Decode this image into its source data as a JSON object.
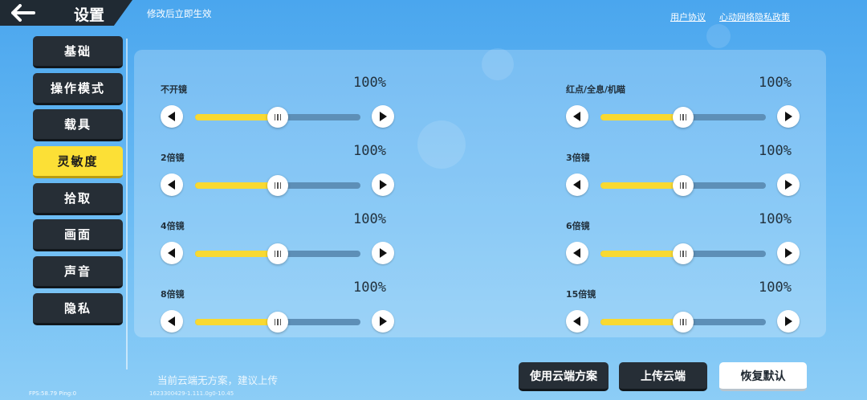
{
  "header": {
    "title": "设置",
    "hint": "修改后立即生效",
    "links": [
      "用户协议",
      "心动网络隐私政策"
    ]
  },
  "sidebar": {
    "items": [
      {
        "label": "基础"
      },
      {
        "label": "操作模式"
      },
      {
        "label": "载具"
      },
      {
        "label": "灵敏度",
        "active": true
      },
      {
        "label": "拾取"
      },
      {
        "label": "画面"
      },
      {
        "label": "声音"
      },
      {
        "label": "隐私"
      }
    ]
  },
  "sliders": [
    {
      "label": "不开镜",
      "value": "100%",
      "level": 0.5
    },
    {
      "label": "红点/全息/机瞄",
      "value": "100%",
      "level": 0.5
    },
    {
      "label": "2倍镜",
      "value": "100%",
      "level": 0.5
    },
    {
      "label": "3倍镜",
      "value": "100%",
      "level": 0.5
    },
    {
      "label": "4倍镜",
      "value": "100%",
      "level": 0.5
    },
    {
      "label": "6倍镜",
      "value": "100%",
      "level": 0.5
    },
    {
      "label": "8倍镜",
      "value": "100%",
      "level": 0.5
    },
    {
      "label": "15倍镜",
      "value": "100%",
      "level": 0.5
    }
  ],
  "footer": {
    "cloud_note": "当前云端无方案，建议上传",
    "use_cloud_label": "使用云端方案",
    "upload_label": "上传云端",
    "restore_label": "恢复默认",
    "fps": "FPS:58.79 Ping:0",
    "build": "1623300429-1.111.0g0-10.45"
  },
  "colors": {
    "accent_yellow": "#fce036",
    "dark_button": "#262e36",
    "track": "#5d8fb7"
  },
  "icons": {
    "back": "back-arrow-icon",
    "decrease": "left-triangle-icon",
    "increase": "right-triangle-icon"
  }
}
